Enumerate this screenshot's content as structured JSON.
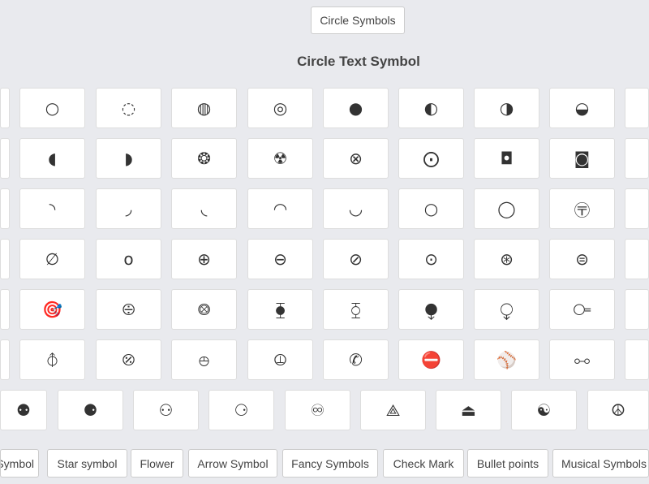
{
  "header": {
    "button": "Circle Symbols",
    "title": "Circle Text Symbol"
  },
  "rows": [
    [
      "",
      "○",
      "◌",
      "◍",
      "◎",
      "●",
      "◐",
      "◑",
      "◒",
      ""
    ],
    [
      "",
      "◖",
      "◗",
      "❂",
      "☢",
      "⊗",
      "⨀",
      "◘",
      "◙",
      ""
    ],
    [
      "",
      "◝",
      "◞",
      "◟",
      "◠",
      "◡",
      "○",
      "◯",
      "〶",
      ""
    ],
    [
      "",
      "∅",
      "o",
      "⊕",
      "⊖",
      "⊘",
      "⊙",
      "⊛",
      "⊜",
      ""
    ],
    [
      "",
      "🎯",
      "⨸",
      "⨷",
      "⧳",
      "⧲",
      "⧭",
      "⧬",
      "⧃",
      ""
    ],
    [
      "",
      "⦽",
      "⦼",
      "⦺",
      "⦹",
      "✆",
      "⛔",
      "⚾",
      "⧟",
      ""
    ],
    [
      "⚉",
      "⚈",
      "⚇",
      "⚆",
      "♾",
      "⟁",
      "⏏",
      "☯",
      "☮"
    ]
  ],
  "bottom_nav": [
    "Symbol",
    "Star symbol",
    "Flower",
    "Arrow Symbol",
    "Fancy Symbols",
    "Check Mark",
    "Bullet points",
    "Musical Symbols"
  ]
}
